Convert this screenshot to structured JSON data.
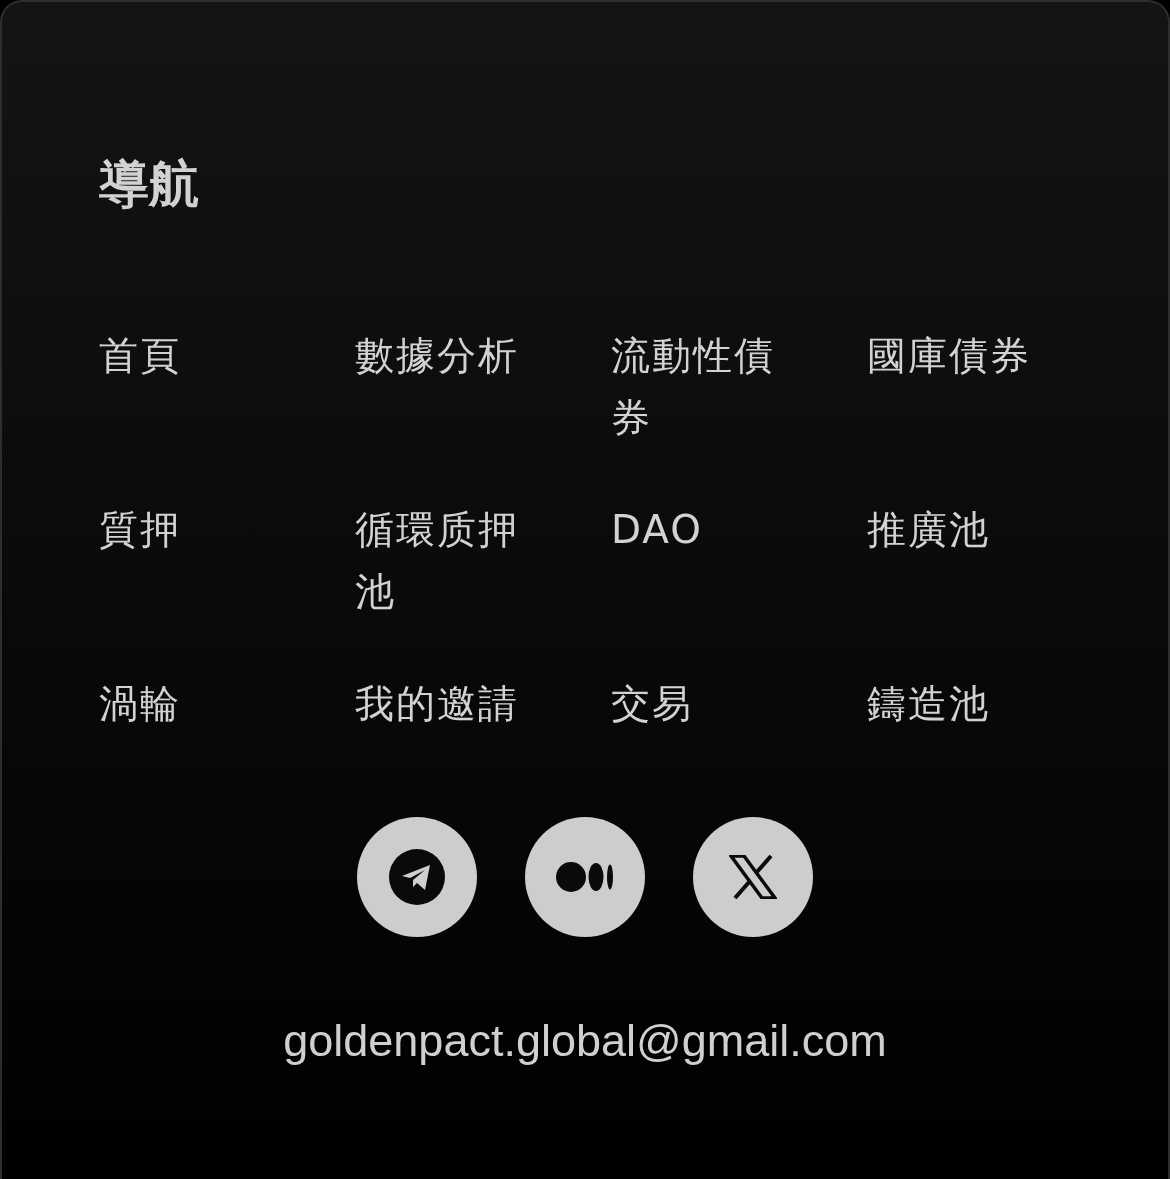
{
  "title": "導航",
  "links": [
    {
      "label": "首頁"
    },
    {
      "label": "數據分析"
    },
    {
      "label": "流動性債券"
    },
    {
      "label": "國庫債券"
    },
    {
      "label": "質押"
    },
    {
      "label": "循環质押池"
    },
    {
      "label": "DAO"
    },
    {
      "label": "推廣池"
    },
    {
      "label": "渦輪"
    },
    {
      "label": "我的邀請"
    },
    {
      "label": "交易"
    },
    {
      "label": "鑄造池"
    }
  ],
  "social": [
    {
      "kind": "telegram"
    },
    {
      "kind": "medium"
    },
    {
      "kind": "x"
    }
  ],
  "email": "goldenpact.global@gmail.com"
}
